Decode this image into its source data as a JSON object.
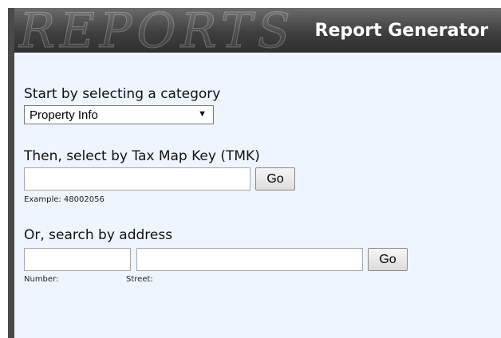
{
  "header": {
    "watermark": "REPORTS",
    "title": "Report Generator"
  },
  "category": {
    "label": "Start by selecting a category",
    "selected": "Property Info"
  },
  "tmk": {
    "label": "Then, select by Tax Map Key (TMK)",
    "value": "",
    "go_label": "Go",
    "example": "Example: 48002056"
  },
  "address": {
    "label": "Or, search by address",
    "number_value": "",
    "street_value": "",
    "go_label": "Go",
    "number_hint": "Number:",
    "street_hint": "Street:"
  },
  "colors": {
    "header_dark": "#3f3f3f",
    "panel_bg": "#eef5ff"
  }
}
